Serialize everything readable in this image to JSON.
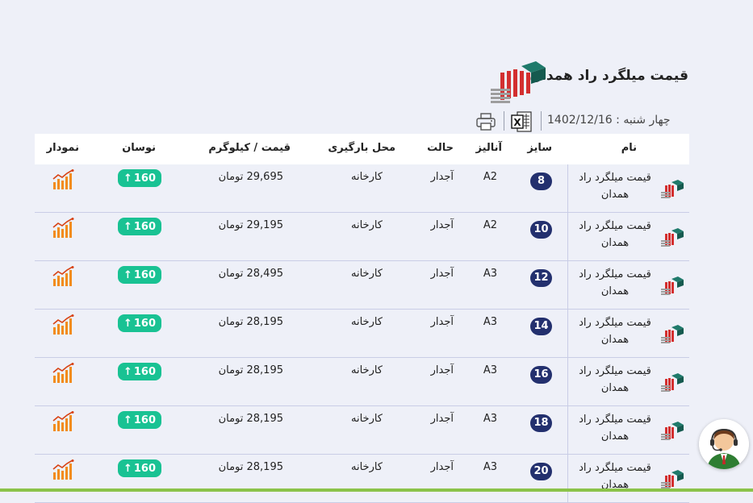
{
  "page": {
    "title": "قیمت میلگرد راد همدان",
    "date": "چهار شنبه : 1402/12/16",
    "excel_label": "X"
  },
  "table": {
    "headers": {
      "name": "نام",
      "size": "سایز",
      "analysis": "آنالیز",
      "state": "حالت",
      "location": "محل بارگیری",
      "price": "قیمت / کیلوگرم",
      "change": "نوسان",
      "chart": "نمودار"
    },
    "rows": [
      {
        "name": "قیمت میلگرد راد همدان",
        "size": "8",
        "analysis": "A2",
        "state": "آجدار",
        "location": "کارخانه",
        "price": "29,695 تومان",
        "change": "160"
      },
      {
        "name": "قیمت میلگرد راد همدان",
        "size": "10",
        "analysis": "A2",
        "state": "آجدار",
        "location": "کارخانه",
        "price": "29,195 تومان",
        "change": "160"
      },
      {
        "name": "قیمت میلگرد راد همدان",
        "size": "12",
        "analysis": "A3",
        "state": "آجدار",
        "location": "کارخانه",
        "price": "28,495 تومان",
        "change": "160"
      },
      {
        "name": "قیمت میلگرد راد همدان",
        "size": "14",
        "analysis": "A3",
        "state": "آجدار",
        "location": "کارخانه",
        "price": "28,195 تومان",
        "change": "160"
      },
      {
        "name": "قیمت میلگرد راد همدان",
        "size": "16",
        "analysis": "A3",
        "state": "آجدار",
        "location": "کارخانه",
        "price": "28,195 تومان",
        "change": "160"
      },
      {
        "name": "قیمت میلگرد راد همدان",
        "size": "18",
        "analysis": "A3",
        "state": "آجدار",
        "location": "کارخانه",
        "price": "28,195 تومان",
        "change": "160"
      },
      {
        "name": "قیمت میلگرد راد همدان",
        "size": "20",
        "analysis": "A3",
        "state": "آجدار",
        "location": "کارخانه",
        "price": "28,195 تومان",
        "change": "160"
      }
    ]
  },
  "icons": {
    "logo": "rebar-logo-icon",
    "excel": "excel-icon",
    "print": "print-icon",
    "chart": "bar-chart-icon",
    "change_arrow": "arrow-up-icon",
    "support": "support-agent-icon"
  },
  "colors": {
    "badge_size": "#23306e",
    "badge_change": "#19c293",
    "chart_orange": "#f28c1e",
    "bottom_line": "#8bc34a"
  }
}
